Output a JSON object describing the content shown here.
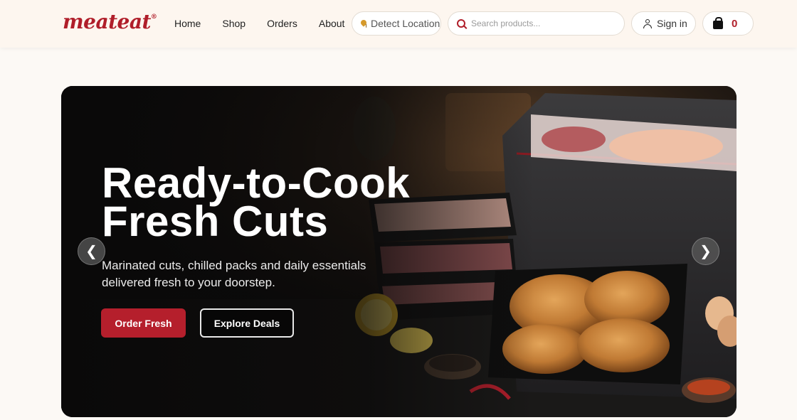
{
  "brand": {
    "logo_text": "meateat",
    "logo_mark": "®"
  },
  "nav": {
    "items": [
      "Home",
      "Shop",
      "Orders",
      "About"
    ]
  },
  "location": {
    "label": "Detect Location",
    "icon": "location-pin-icon"
  },
  "search": {
    "placeholder": "Search products...",
    "value": "",
    "icon": "search-icon"
  },
  "account": {
    "label": "Sign in",
    "icon": "user-icon"
  },
  "cart": {
    "count": "0",
    "icon": "shopping-bag-icon"
  },
  "hero": {
    "title_line1": "Ready-to-Cook",
    "title_line2": "Fresh Cuts",
    "subtitle": "Marinated cuts, chilled packs and daily essentials delivered fresh to your doorstep.",
    "primary_cta": "Order Fresh",
    "secondary_cta": "Explore Deals",
    "prev_arrow": "❮",
    "next_arrow": "❯"
  },
  "colors": {
    "brand_red": "#b01e2a",
    "header_bg": "#fdf6ef",
    "page_bg": "#fcf9f5",
    "cta_red": "#b51f2c",
    "pin_gold": "#d69a2b"
  }
}
